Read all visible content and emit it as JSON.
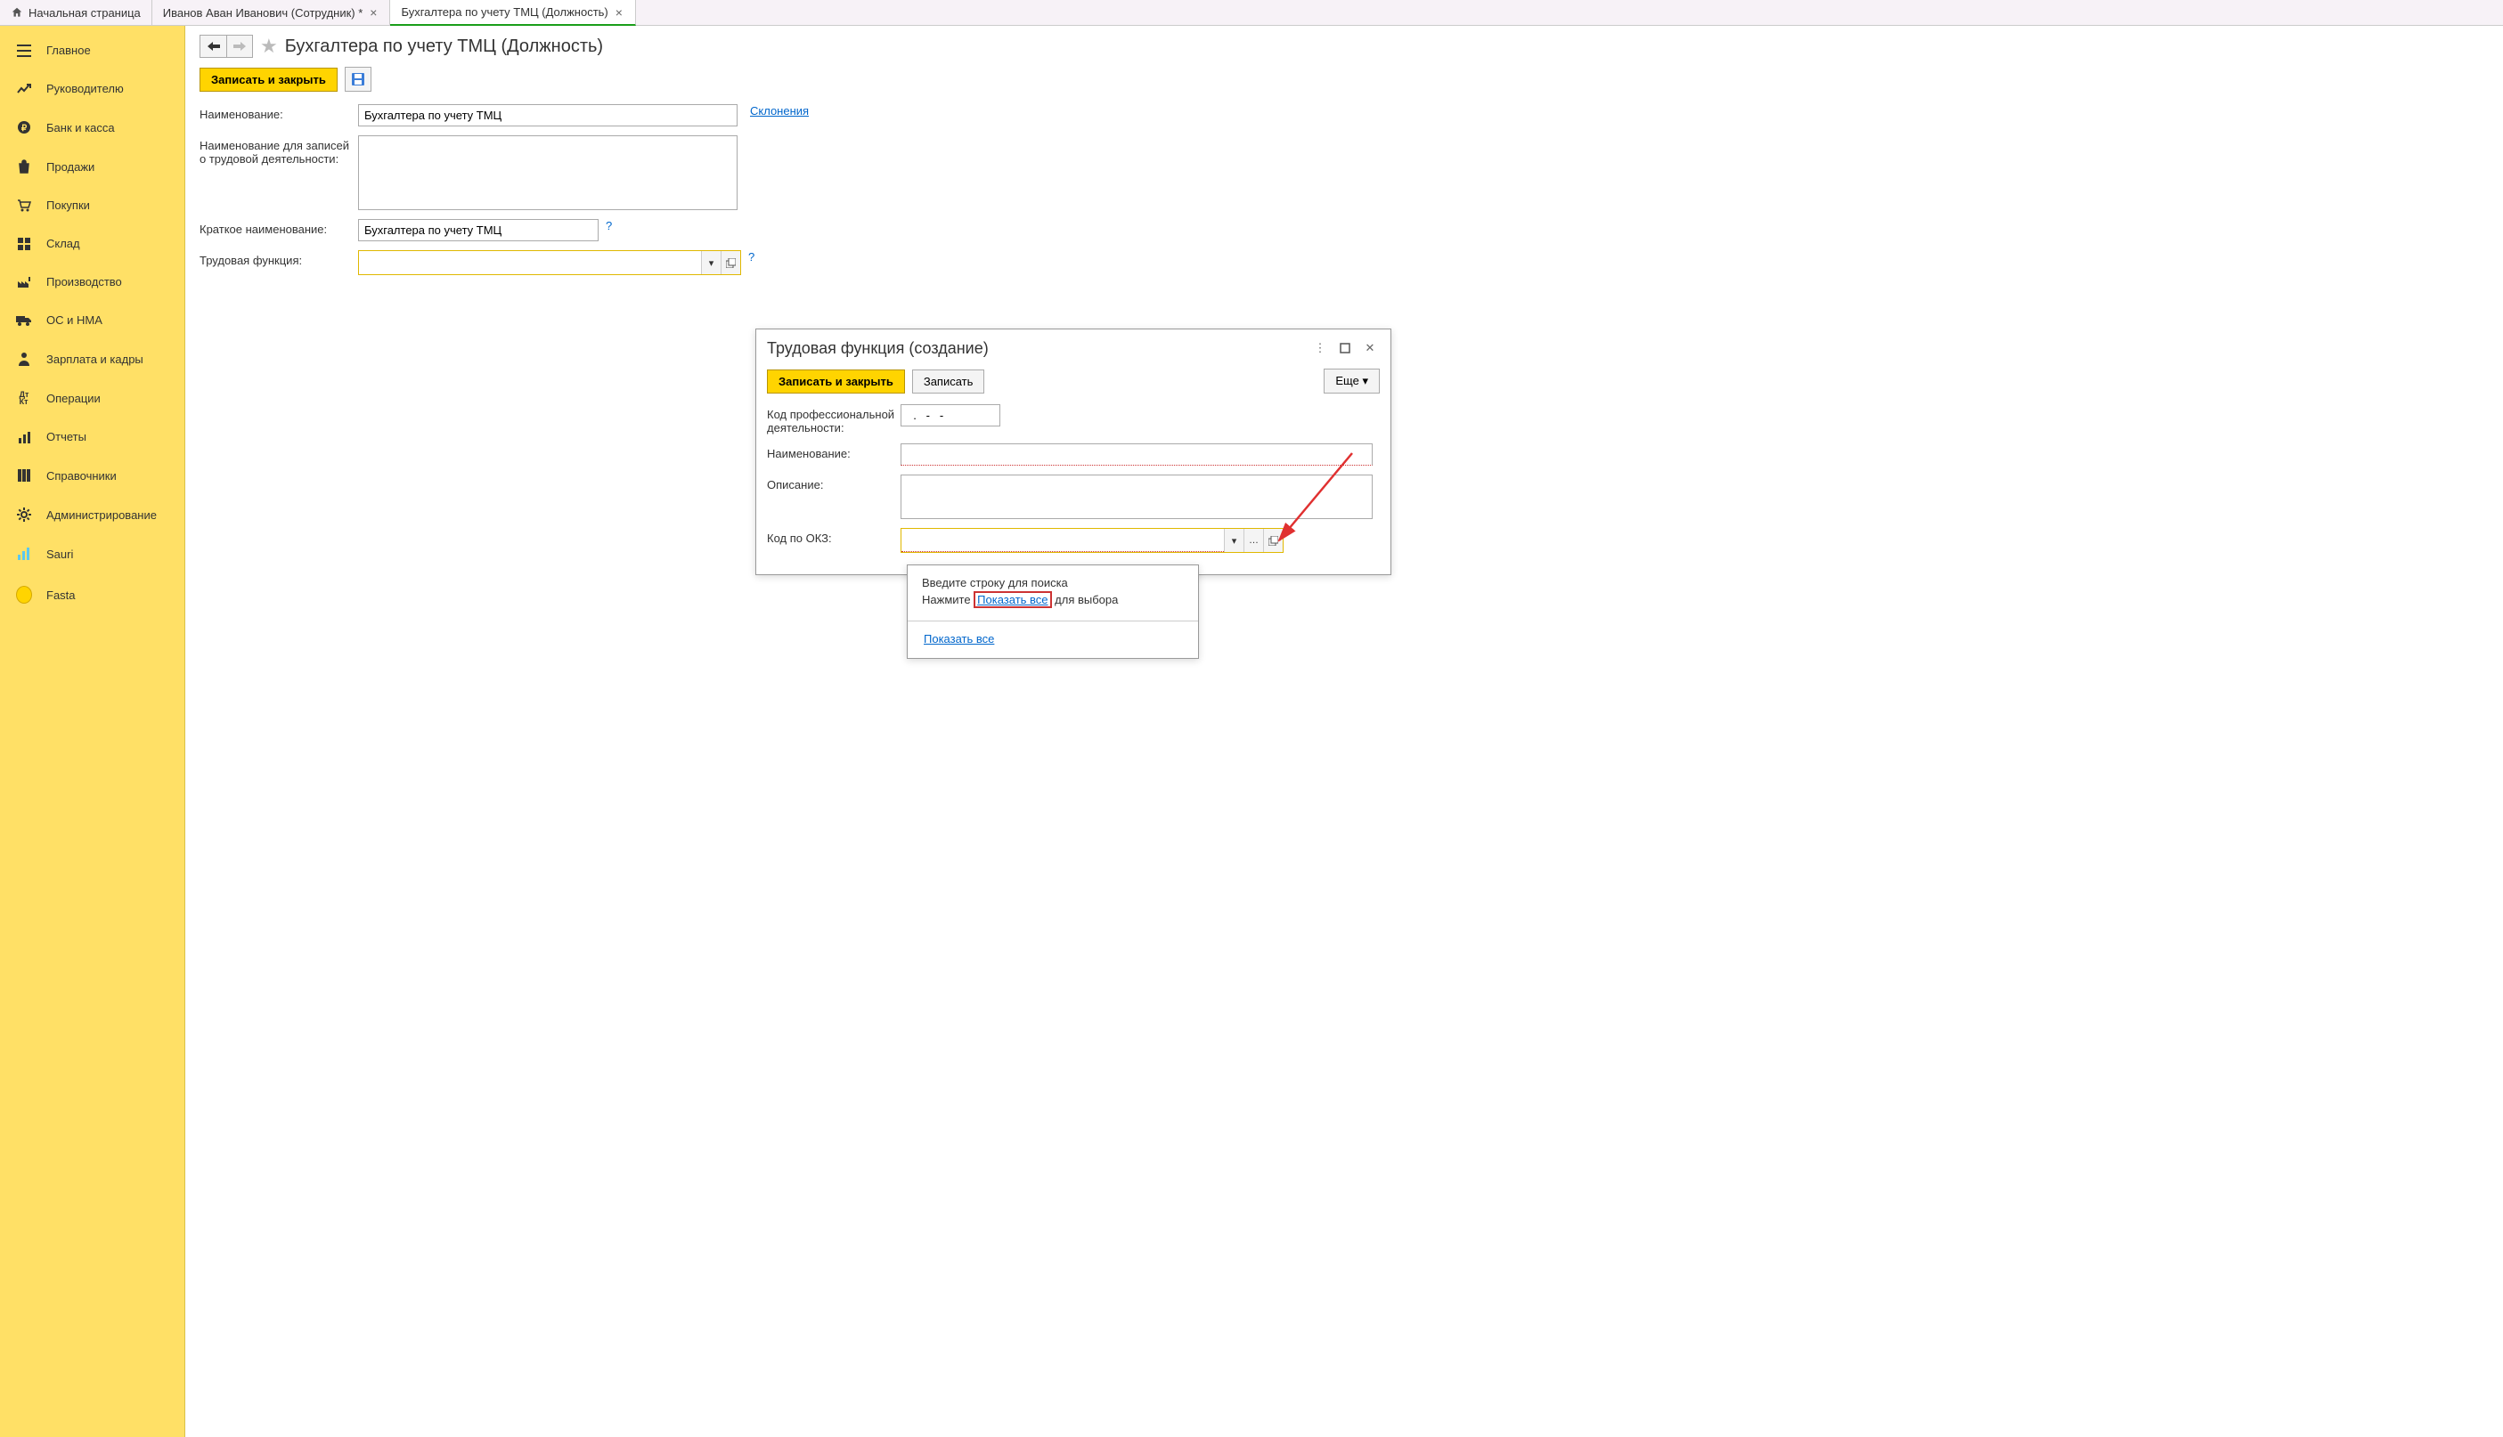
{
  "tabs": {
    "home": "Начальная страница",
    "tab1": "Иванов Аван Иванович (Сотрудник) *",
    "tab2": "Бухгалтера по учету ТМЦ (Должность)"
  },
  "sidebar": {
    "items": [
      {
        "label": "Главное"
      },
      {
        "label": "Руководителю"
      },
      {
        "label": "Банк и касса"
      },
      {
        "label": "Продажи"
      },
      {
        "label": "Покупки"
      },
      {
        "label": "Склад"
      },
      {
        "label": "Производство"
      },
      {
        "label": "ОС и НМА"
      },
      {
        "label": "Зарплата и кадры"
      },
      {
        "label": "Операции"
      },
      {
        "label": "Отчеты"
      },
      {
        "label": "Справочники"
      },
      {
        "label": "Администрирование"
      },
      {
        "label": "Sauri"
      },
      {
        "label": "Fasta"
      }
    ]
  },
  "page": {
    "title": "Бухгалтера по учету ТМЦ (Должность)",
    "save_close": "Записать и закрыть",
    "labels": {
      "name": "Наименование:",
      "name_ezd": "Наименование для записей о трудовой деятельности:",
      "short_name": "Краткое наименование:",
      "labor_func": "Трудовая функция:"
    },
    "values": {
      "name": "Бухгалтера по учету ТМЦ",
      "name_ezd": "",
      "short_name": "Бухгалтера по учету ТМЦ",
      "labor_func": ""
    },
    "links": {
      "declensions": "Склонения"
    }
  },
  "modal": {
    "title": "Трудовая функция (создание)",
    "save_close": "Записать и закрыть",
    "save": "Записать",
    "more": "Еще",
    "labels": {
      "prof_code": "Код профессиональной деятельности:",
      "name": "Наименование:",
      "desc": "Описание:",
      "okz": "Код по ОКЗ:"
    },
    "values": {
      "prof_code": "  .   -   -",
      "name": "",
      "desc": "",
      "okz": ""
    }
  },
  "popup": {
    "line1": "Введите строку для поиска",
    "line2_a": "Нажмите ",
    "line2_link": "Показать все",
    "line2_b": " для выбора",
    "show_all": "Показать все"
  }
}
